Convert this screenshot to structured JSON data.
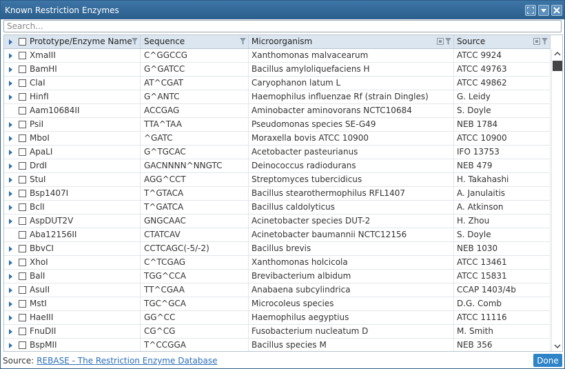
{
  "window": {
    "title": "Known Restriction Enzymes"
  },
  "search": {
    "placeholder": "Search..."
  },
  "columns": [
    "Prototype/Enzyme Name",
    "Sequence",
    "Microorganism",
    "Source"
  ],
  "rows": [
    {
      "name": "XmaIII",
      "seq": "C^GGCCG",
      "org": "Xanthomonas malvacearum",
      "src": "ATCC 9924",
      "expandable": true
    },
    {
      "name": "BamHI",
      "seq": "G^GATCC",
      "org": "Bacillus amyloliquefaciens H",
      "src": "ATCC 49763",
      "expandable": true
    },
    {
      "name": "ClaI",
      "seq": "AT^CGAT",
      "org": "Caryophanon latum L",
      "src": "ATCC 49862",
      "expandable": true
    },
    {
      "name": "HinfI",
      "seq": "G^ANTC",
      "org": "Haemophilus influenzae Rf (strain Dingles)",
      "src": "G. Leidy",
      "expandable": true
    },
    {
      "name": "Aam10684II",
      "seq": "ACCGAG",
      "org": "Aminobacter aminovorans NCTC10684",
      "src": "S. Doyle",
      "expandable": false
    },
    {
      "name": "PsiI",
      "seq": "TTA^TAA",
      "org": "Pseudomonas species SE-G49",
      "src": "NEB 1784",
      "expandable": true
    },
    {
      "name": "MboI",
      "seq": "^GATC",
      "org": "Moraxella bovis ATCC 10900",
      "src": "ATCC 10900",
      "expandable": true
    },
    {
      "name": "ApaLI",
      "seq": "G^TGCAC",
      "org": "Acetobacter pasteurianus",
      "src": "IFO 13753",
      "expandable": true
    },
    {
      "name": "DrdI",
      "seq": "GACNNNN^NNGTC",
      "org": "Deinococcus radiodurans",
      "src": "NEB 479",
      "expandable": true
    },
    {
      "name": "StuI",
      "seq": "AGG^CCT",
      "org": "Streptomyces tubercidicus",
      "src": "H. Takahashi",
      "expandable": true
    },
    {
      "name": "Bsp1407I",
      "seq": "T^GTACA",
      "org": "Bacillus stearothermophilus RFL1407",
      "src": "A. Janulaitis",
      "expandable": true
    },
    {
      "name": "BclI",
      "seq": "T^GATCA",
      "org": "Bacillus caldolyticus",
      "src": "A. Atkinson",
      "expandable": true
    },
    {
      "name": "AspDUT2V",
      "seq": "GNGCAAC",
      "org": "Acinetobacter species DUT-2",
      "src": "H. Zhou",
      "expandable": true
    },
    {
      "name": "Aba12156II",
      "seq": "CTATCAV",
      "org": "Acinetobacter baumannii NCTC12156",
      "src": "S. Doyle",
      "expandable": false
    },
    {
      "name": "BbvCI",
      "seq": "CCTCAGC(-5/-2)",
      "org": "Bacillus brevis",
      "src": "NEB 1030",
      "expandable": true
    },
    {
      "name": "XhoI",
      "seq": "C^TCGAG",
      "org": "Xanthomonas holcicola",
      "src": "ATCC 13461",
      "expandable": true
    },
    {
      "name": "BalI",
      "seq": "TGG^CCA",
      "org": "Brevibacterium albidum",
      "src": "ATCC 15831",
      "expandable": true
    },
    {
      "name": "AsuII",
      "seq": "TT^CGAA",
      "org": "Anabaena subcylindrica",
      "src": "CCAP 1403/4b",
      "expandable": true
    },
    {
      "name": "MstI",
      "seq": "TGC^GCA",
      "org": "Microcoleus species",
      "src": "D.G. Comb",
      "expandable": true
    },
    {
      "name": "HaeIII",
      "seq": "GG^CC",
      "org": "Haemophilus aegyptius",
      "src": "ATCC 11116",
      "expandable": true
    },
    {
      "name": "FnuDII",
      "seq": "CG^CG",
      "org": "Fusobacterium nucleatum D",
      "src": "M. Smith",
      "expandable": true
    },
    {
      "name": "BspMII",
      "seq": "T^CCGGA",
      "org": "Bacillus species M",
      "src": "NEB 356",
      "expandable": true
    }
  ],
  "footer": {
    "source_label": "Source:",
    "source_link": "REBASE - The Restriction Enzyme Database",
    "done_label": "Done"
  },
  "colors": {
    "titlebar": "#2b5e8c",
    "header": "#dbe6f0",
    "link": "#2a6ebb",
    "done": "#2f84c8"
  }
}
